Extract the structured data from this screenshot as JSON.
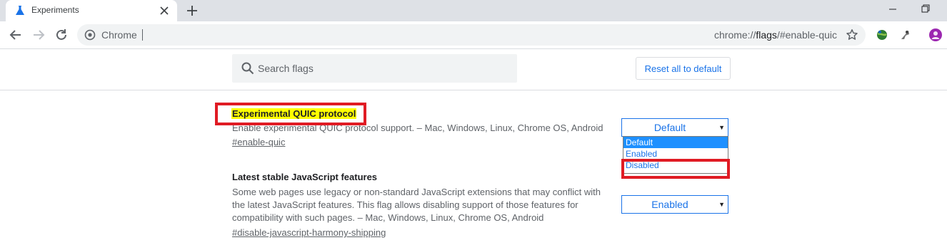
{
  "tab": {
    "title": "Experiments"
  },
  "omnibox": {
    "site_chip": "Chrome",
    "url_prefix": "chrome://",
    "url_main": "flags",
    "url_suffix": "/#enable-quic"
  },
  "search": {
    "placeholder": "Search flags"
  },
  "reset_label": "Reset all to default",
  "flags": [
    {
      "title": "Experimental QUIC protocol",
      "description": "Enable experimental QUIC protocol support. – Mac, Windows, Linux, Chrome OS, Android",
      "link": "#enable-quic",
      "selected": "Default",
      "options": [
        "Default",
        "Enabled",
        "Disabled"
      ]
    },
    {
      "title": "Latest stable JavaScript features",
      "description_lines": [
        "Some web pages use legacy or non-standard JavaScript extensions that may conflict with",
        "the latest JavaScript features. This flag allows disabling support of those features for",
        "compatibility with such pages. – Mac, Windows, Linux, Chrome OS, Android"
      ],
      "link": "#disable-javascript-harmony-shipping",
      "selected": "Enabled"
    }
  ],
  "colors": {
    "accent": "#1a73e8",
    "highlight": "#ffff00",
    "annotation": "#e01b24",
    "selected_option": "#1e90ff"
  },
  "icons": [
    "flask-icon",
    "close-icon",
    "plus-icon",
    "minimize-icon",
    "restore-icon",
    "back-arrow-icon",
    "forward-arrow-icon",
    "reload-icon",
    "chrome-icon",
    "star-icon",
    "extension-globe-icon",
    "extension-puzzle-icon",
    "profile-avatar-icon",
    "search-icon",
    "dropdown-arrow-icon"
  ]
}
